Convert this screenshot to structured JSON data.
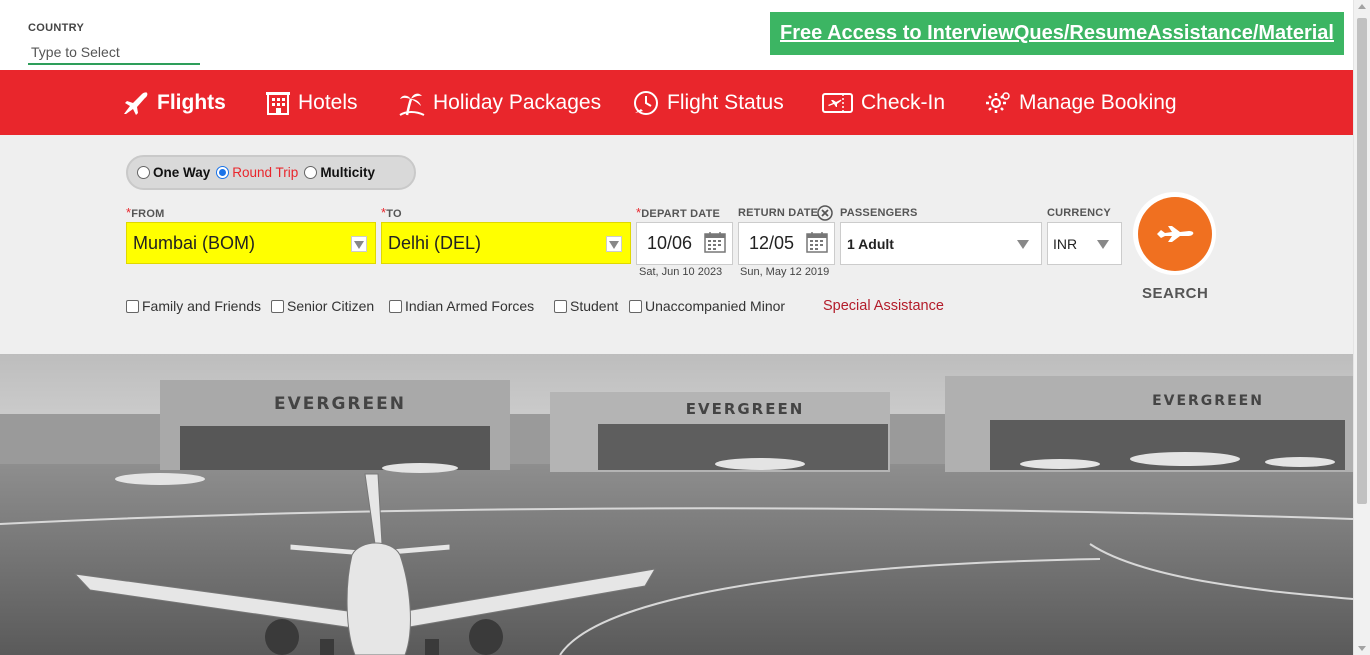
{
  "country": {
    "label": "COUNTRY",
    "placeholder": "Type to Select"
  },
  "promo": {
    "text": "Free Access to InterviewQues/ResumeAssistance/Material"
  },
  "nav": {
    "items": [
      {
        "label": "Flights",
        "icon": "plane-icon"
      },
      {
        "label": "Hotels",
        "icon": "hotel-icon"
      },
      {
        "label": "Holiday Packages",
        "icon": "palm-tree-icon"
      },
      {
        "label": "Flight Status",
        "icon": "flight-status-icon"
      },
      {
        "label": "Check-In",
        "icon": "ticket-icon"
      },
      {
        "label": "Manage Booking",
        "icon": "gear-icon"
      }
    ]
  },
  "trip_type": {
    "options": [
      "One Way",
      "Round Trip",
      "Multicity"
    ],
    "selected": "Round Trip"
  },
  "from": {
    "label": "FROM",
    "value": "Mumbai (BOM)"
  },
  "to": {
    "label": "TO",
    "value": "Delhi (DEL)"
  },
  "depart": {
    "label": "DEPART DATE",
    "value": "10/06",
    "sub": "Sat, Jun 10 2023"
  },
  "return_date": {
    "label": "RETURN DATE",
    "value": "12/05",
    "sub": "Sun, May 12 2019"
  },
  "passengers": {
    "label": "PASSENGERS",
    "value": "1 Adult"
  },
  "currency": {
    "label": "CURRENCY",
    "value": "INR"
  },
  "search": {
    "label": "SEARCH"
  },
  "discounts": [
    "Family and Friends",
    "Senior Citizen",
    "Indian Armed Forces",
    "Student",
    "Unaccompanied Minor"
  ],
  "special_assistance": "Special Assistance",
  "hero": {
    "signs": [
      "EVERGREEN",
      "EVERGREEN",
      "EVERGREEN"
    ]
  },
  "colors": {
    "nav_red": "#e9262c",
    "promo_green": "#3cb563",
    "search_orange": "#f07020",
    "city_yellow": "#ffff00"
  }
}
